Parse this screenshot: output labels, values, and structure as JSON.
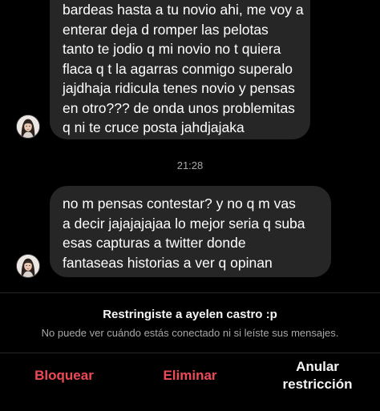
{
  "messages": [
    {
      "lines": [
        "bardeas hasta a tu novio ahi, me voy a",
        "enterar deja d romper las pelotas",
        "tanto te jodio q mi novio no t quiera",
        "flaca q t la agarras conmigo superalo",
        "jajdhaja ridicula tenes novio y pensas",
        "en otro??? de onda unos problemitas",
        "q ni te cruce posta jahdjajaka"
      ]
    },
    {
      "lines": [
        "no m pensas contestar? y no q m vas",
        "a decir jajajajajaa lo mejor seria q suba",
        "esas capturas a twitter donde",
        "fantaseas historias a ver q opinan"
      ]
    }
  ],
  "timestamp": "21:28",
  "restriction": {
    "title": "Restringiste a ayelen castro :p",
    "subtitle": "No puede ver cuándo estás conectado ni si leíste sus mensajes."
  },
  "actions": {
    "block": "Bloquear",
    "delete": "Eliminar",
    "unrestrict_line1": "Anular",
    "unrestrict_line2": "restricción"
  },
  "colors": {
    "background": "#000000",
    "bubble": "#262626",
    "destructive": "#ed4956",
    "secondary_text": "#a8a8a8"
  }
}
